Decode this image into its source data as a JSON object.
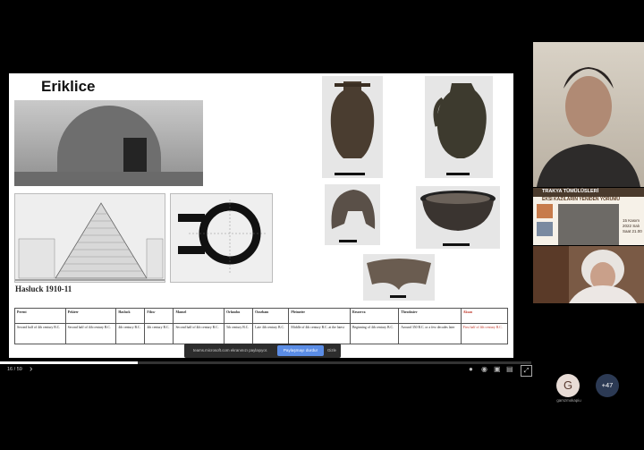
{
  "slide": {
    "title": "Eriklice",
    "caption": "Hasluck 1910-11",
    "table": {
      "headers": [
        "Perent",
        "Pekirer",
        "Hasluck",
        "Filow",
        "Mansel",
        "Orlandos",
        "Oosebam",
        "Pfeimeier",
        "Resserva",
        "Theodosiev",
        "Aksan"
      ],
      "rows": [
        [
          "Second half of 4th century B.C.",
          "Second half of 4th century B.C.",
          "4th century B.C.",
          "4th century B.C.",
          "Second half of 4th century B.C.",
          "5th century B.C.",
          "Late 4th century B.C.",
          "Middle of 4th century B.C. at the latest",
          "Beginning of 4th century B.C.",
          "Around 350 B.C. or a few decades later",
          "First half of 4th century B.C."
        ]
      ]
    }
  },
  "share_bar": {
    "text": "teams.microsoft.com ekranınızı paylaşıyor.",
    "stop_label": "Paylaşmayı durdur",
    "hide_label": "Gizle"
  },
  "controls": {
    "page": "16 / 59",
    "progress": 0.26
  },
  "side_panel": {
    "poster_title": "EKSİ KAZILARIN YENİDEN YORUMU",
    "poster_header": "TRAKYA TÜMÜLÜSLERİ",
    "poster_date": "15 Kasım 2022 Salı Saat 21.00"
  },
  "participants": {
    "avatar_letter": "G",
    "avatar_name": "gamzmokapiu",
    "more": "+47"
  }
}
